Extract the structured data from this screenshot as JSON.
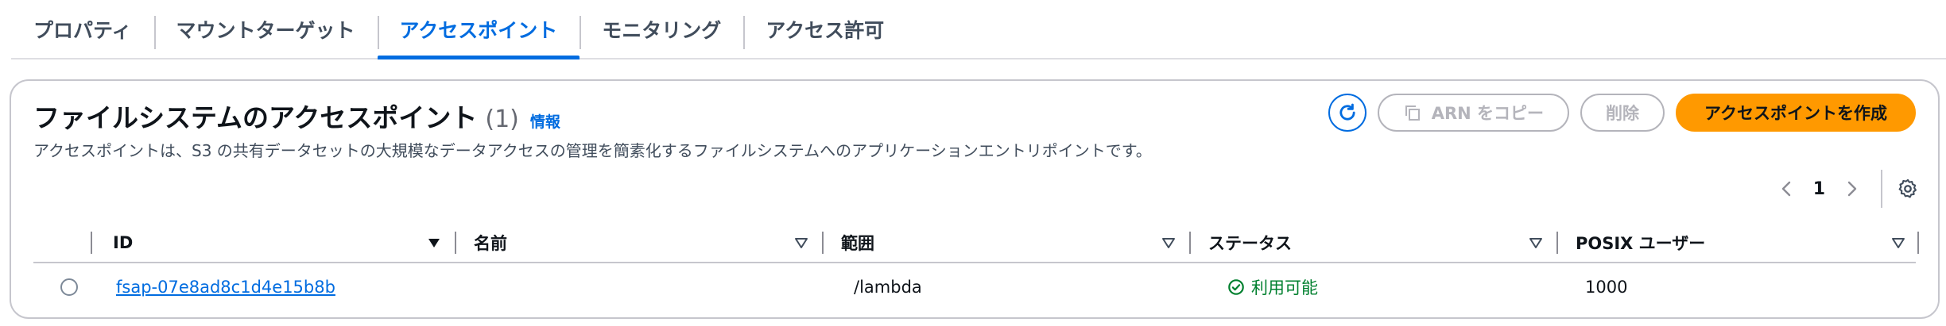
{
  "tabs": [
    {
      "label": "プロパティ"
    },
    {
      "label": "マウントターゲット"
    },
    {
      "label": "アクセスポイント"
    },
    {
      "label": "モニタリング"
    },
    {
      "label": "アクセス許可"
    }
  ],
  "header": {
    "title": "ファイルシステムのアクセスポイント",
    "count": "(1)",
    "info": "情報",
    "description": "アクセスポイントは、S3 の共有データセットの大規模なデータアクセスの管理を簡素化するファイルシステムへのアプリケーションエントリポイントです。"
  },
  "actions": {
    "refresh_icon": "refresh-icon",
    "copy_arn": "ARN をコピー",
    "delete": "削除",
    "create": "アクセスポイントを作成"
  },
  "pagination": {
    "current_page": "1"
  },
  "table": {
    "columns": [
      "ID",
      "名前",
      "範囲",
      "ステータス",
      "POSIX ユーザー"
    ],
    "rows": [
      {
        "id": "fsap-07e8ad8c1d4e15b8b",
        "name": "",
        "scope": "/lambda",
        "status": "利用可能",
        "posix_user": "1000"
      }
    ]
  },
  "colors": {
    "accent": "#006ce0",
    "primary_button": "#ff9900",
    "status_ok": "#00802f",
    "disabled": "#b4b4bb"
  }
}
